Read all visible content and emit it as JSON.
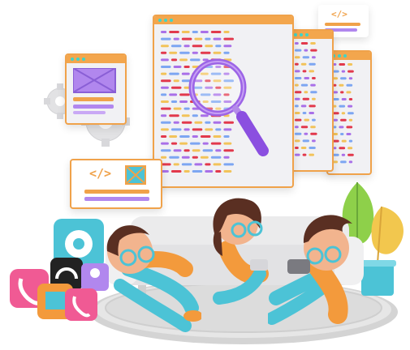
{
  "illustration": {
    "code_symbol": "</>",
    "colors": {
      "window_frame": "#f0a24a",
      "window_header": "#f3a64d",
      "window_bg": "#f1f1f4",
      "code_purple": "#a970e8",
      "code_red": "#e2394c",
      "code_yellow": "#f2c35a",
      "code_blue": "#7da6f2",
      "teal": "#3fd4c8",
      "skin": "#f2b48e",
      "hair": "#5a2f22",
      "shirt": "#f39a3c",
      "pants": "#4cc3d6",
      "sofa": "#e9e9ea",
      "rug": "#cfcfcf",
      "plant_green": "#8ed04a",
      "plant_yellow": "#f2c74e"
    },
    "icons": [
      "gear-icon",
      "magnifier-icon",
      "code-icon",
      "image-icon",
      "phone-icon",
      "headset-icon",
      "person-icon"
    ]
  }
}
